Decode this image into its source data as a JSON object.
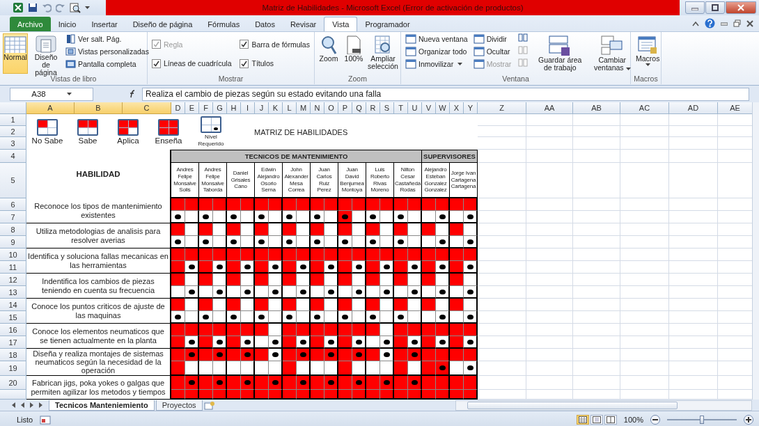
{
  "window": {
    "title": "Matriz de Habilidades  -  Microsoft Excel (Error de activación de productos)"
  },
  "ribbon_tabs": [
    {
      "label": "Archivo",
      "selected": false,
      "kind": "file"
    },
    {
      "label": "Inicio",
      "selected": false,
      "kind": "tab"
    },
    {
      "label": "Insertar",
      "selected": false,
      "kind": "tab"
    },
    {
      "label": "Diseño de página",
      "selected": false,
      "kind": "tab"
    },
    {
      "label": "Fórmulas",
      "selected": false,
      "kind": "tab"
    },
    {
      "label": "Datos",
      "selected": false,
      "kind": "tab"
    },
    {
      "label": "Revisar",
      "selected": false,
      "kind": "tab"
    },
    {
      "label": "Vista",
      "selected": true,
      "kind": "tab"
    },
    {
      "label": "Programador",
      "selected": false,
      "kind": "tab"
    }
  ],
  "ribbon": {
    "workbook_views": {
      "label": "Vistas de libro",
      "large": [
        {
          "label": "Normal",
          "selected": true
        },
        {
          "label": "Diseño de página",
          "selected": false
        }
      ],
      "small": [
        "Ver salt. Pág.",
        "Vistas personalizadas",
        "Pantalla completa"
      ]
    },
    "show": {
      "label": "Mostrar",
      "options": [
        {
          "label": "Regla",
          "checked": true,
          "disabled": true
        },
        {
          "label": "Líneas de cuadrícula",
          "checked": true,
          "disabled": false
        },
        {
          "label": "Barra de fórmulas",
          "checked": true,
          "disabled": false
        },
        {
          "label": "Títulos",
          "checked": true,
          "disabled": false
        }
      ]
    },
    "zoom": {
      "label": "Zoom",
      "buttons": [
        "Zoom",
        "100%",
        "Ampliar selección"
      ]
    },
    "window": {
      "label": "Ventana",
      "small": [
        {
          "label": "Nueva ventana",
          "disabled": false,
          "dropdown": false
        },
        {
          "label": "Organizar todo",
          "disabled": false,
          "dropdown": false
        },
        {
          "label": "Inmovilizar",
          "disabled": false,
          "dropdown": true
        },
        {
          "label": "Dividir",
          "disabled": false,
          "dropdown": false
        },
        {
          "label": "Ocultar",
          "disabled": false,
          "dropdown": false
        },
        {
          "label": "Mostrar",
          "disabled": true,
          "dropdown": false
        }
      ],
      "large": [
        {
          "label": "Guardar área de trabajo",
          "dropdown": false
        },
        {
          "label": "Cambiar ventanas",
          "dropdown": true
        }
      ]
    },
    "macros": {
      "label": "Macros",
      "buttons": [
        {
          "label": "Macros",
          "dropdown": true
        }
      ]
    }
  },
  "formula_bar": {
    "name_box": "A38",
    "formula": "Realiza el cambio de piezas según su estado evitando una falla"
  },
  "column_headers": [
    {
      "label": "A",
      "selected": true
    },
    {
      "label": "B",
      "selected": true
    },
    {
      "label": "C",
      "selected": true
    },
    {
      "label": "D",
      "selected": false
    },
    {
      "label": "E",
      "selected": false
    },
    {
      "label": "F",
      "selected": false
    },
    {
      "label": "G",
      "selected": false
    },
    {
      "label": "H",
      "selected": false
    },
    {
      "label": "I",
      "selected": false
    },
    {
      "label": "J",
      "selected": false
    },
    {
      "label": "K",
      "selected": false
    },
    {
      "label": "L",
      "selected": false
    },
    {
      "label": "M",
      "selected": false
    },
    {
      "label": "N",
      "selected": false
    },
    {
      "label": "O",
      "selected": false
    },
    {
      "label": "P",
      "selected": false
    },
    {
      "label": "Q",
      "selected": false
    },
    {
      "label": "R",
      "selected": false
    },
    {
      "label": "S",
      "selected": false
    },
    {
      "label": "T",
      "selected": false
    },
    {
      "label": "U",
      "selected": false
    },
    {
      "label": "V",
      "selected": false
    },
    {
      "label": "W",
      "selected": false
    },
    {
      "label": "X",
      "selected": false
    },
    {
      "label": "Y",
      "selected": false
    },
    {
      "label": "Z",
      "selected": false
    },
    {
      "label": "AA",
      "selected": false
    },
    {
      "label": "AB",
      "selected": false
    },
    {
      "label": "AC",
      "selected": false
    },
    {
      "label": "AD",
      "selected": false
    },
    {
      "label": "AE",
      "selected": false
    }
  ],
  "row_headers": [
    "1",
    "2",
    "3",
    "4",
    "5",
    "6",
    "7",
    "8",
    "9",
    "10",
    "11",
    "12",
    "13",
    "14",
    "15",
    "16",
    "17",
    "18",
    "19",
    "20"
  ],
  "legend": {
    "title": "MATRIZ DE HABILIDADES",
    "items": [
      {
        "label": "No Sabe",
        "quadrants": [
          true,
          false,
          false,
          false
        ],
        "dot": false
      },
      {
        "label": "Sabe",
        "quadrants": [
          true,
          true,
          false,
          false
        ],
        "dot": false
      },
      {
        "label": "Aplica",
        "quadrants": [
          true,
          true,
          true,
          false
        ],
        "dot": false
      },
      {
        "label": "Enseña",
        "quadrants": [
          true,
          true,
          true,
          true
        ],
        "dot": false
      },
      {
        "label": "Nivel Requerido",
        "quadrants": [
          false,
          false,
          false,
          false
        ],
        "dot": true
      }
    ]
  },
  "matrix": {
    "skill_header": "HABILIDAD",
    "groups": [
      {
        "label": "TECNICOS DE MANTENIMIENTO",
        "people": [
          "Andres Felipe Monsalve Solis",
          "Andres Felipe Monsalve Taborda",
          "Daniel Grisales Cano",
          "Edwin Alejandro Osorio Serna",
          "John Alexander Mesa Correa",
          "Juan Carlos Ruiz Perez",
          "Juan David Benjumea Montoya",
          "Luis Roberto Rivas Moreno",
          "Nilton Cesar Castañeda Rodas"
        ]
      },
      {
        "label": "SUPERVISORES",
        "people": [
          "Alejandro Esteban Gonzalez Gonzalez",
          "Jorge Ivan Cartagena Cartagena"
        ]
      }
    ],
    "skills": [
      {
        "label": "Reconoce los tipos de mantenimiento existentes",
        "rows": [
          {
            "red": [
              true,
              true,
              true,
              true,
              true,
              true,
              true,
              true,
              true,
              true,
              true,
              true,
              true,
              true,
              true,
              true,
              true,
              true,
              true,
              true,
              true,
              true
            ],
            "dot": [
              false,
              false,
              false,
              false,
              false,
              false,
              false,
              false,
              false,
              false,
              false,
              false,
              false,
              false,
              false,
              false,
              false,
              false,
              false,
              false,
              false,
              false
            ]
          },
          {
            "red": [
              false,
              false,
              false,
              false,
              false,
              false,
              false,
              false,
              false,
              false,
              false,
              false,
              true,
              false,
              false,
              false,
              false,
              false,
              false,
              false,
              false,
              false
            ],
            "dot": [
              true,
              false,
              true,
              false,
              true,
              false,
              true,
              false,
              true,
              false,
              true,
              false,
              true,
              false,
              true,
              false,
              true,
              false,
              false,
              true,
              false,
              true
            ]
          }
        ]
      },
      {
        "label": "Utiliza metodologias de analisis para resolver averias",
        "rows": [
          {
            "red": [
              true,
              false,
              true,
              false,
              true,
              false,
              true,
              false,
              true,
              false,
              true,
              false,
              true,
              false,
              true,
              false,
              true,
              false,
              true,
              false,
              true,
              false
            ],
            "dot": [
              false,
              false,
              false,
              false,
              false,
              false,
              false,
              false,
              false,
              false,
              false,
              false,
              false,
              false,
              false,
              false,
              false,
              false,
              false,
              false,
              false,
              false
            ]
          },
          {
            "red": [
              false,
              false,
              false,
              false,
              false,
              false,
              false,
              false,
              false,
              false,
              false,
              false,
              false,
              false,
              false,
              false,
              false,
              false,
              false,
              false,
              false,
              false
            ],
            "dot": [
              true,
              false,
              true,
              false,
              true,
              false,
              true,
              false,
              true,
              false,
              true,
              false,
              true,
              false,
              true,
              false,
              true,
              false,
              false,
              true,
              false,
              true
            ]
          }
        ]
      },
      {
        "label": "Identifica y soluciona fallas mecanicas en las herramientas",
        "rows": [
          {
            "red": [
              true,
              true,
              true,
              true,
              true,
              true,
              true,
              true,
              true,
              true,
              true,
              true,
              true,
              true,
              true,
              true,
              true,
              true,
              true,
              true,
              true,
              true
            ],
            "dot": [
              false,
              false,
              false,
              false,
              false,
              false,
              false,
              false,
              false,
              false,
              false,
              false,
              false,
              false,
              false,
              false,
              false,
              false,
              false,
              false,
              false,
              false
            ]
          },
          {
            "red": [
              true,
              false,
              true,
              false,
              true,
              false,
              true,
              false,
              true,
              false,
              true,
              false,
              true,
              false,
              true,
              false,
              true,
              false,
              true,
              false,
              true,
              false
            ],
            "dot": [
              false,
              true,
              false,
              true,
              false,
              true,
              false,
              true,
              false,
              true,
              false,
              true,
              false,
              true,
              false,
              true,
              false,
              true,
              false,
              true,
              false,
              true
            ]
          }
        ]
      },
      {
        "label": "Indentifica los cambios de piezas teniendo en cuenta su frecuencia",
        "rows": [
          {
            "red": [
              true,
              false,
              true,
              false,
              true,
              false,
              true,
              false,
              true,
              false,
              true,
              false,
              true,
              false,
              true,
              false,
              true,
              false,
              true,
              false,
              true,
              false
            ],
            "dot": [
              false,
              false,
              false,
              false,
              false,
              false,
              false,
              false,
              false,
              false,
              false,
              false,
              false,
              false,
              false,
              false,
              false,
              false,
              false,
              false,
              false,
              false
            ]
          },
          {
            "red": [
              false,
              false,
              false,
              false,
              false,
              false,
              false,
              false,
              false,
              false,
              false,
              false,
              false,
              false,
              false,
              false,
              false,
              false,
              false,
              false,
              false,
              false
            ],
            "dot": [
              false,
              true,
              false,
              true,
              false,
              true,
              false,
              true,
              false,
              true,
              false,
              true,
              false,
              true,
              false,
              true,
              false,
              true,
              false,
              true,
              false,
              true
            ]
          }
        ]
      },
      {
        "label": "Conoce los puntos criticos de ajuste de las maquinas",
        "rows": [
          {
            "red": [
              true,
              false,
              true,
              false,
              true,
              false,
              true,
              false,
              true,
              false,
              true,
              false,
              true,
              false,
              true,
              false,
              true,
              false,
              true,
              false,
              true,
              false
            ],
            "dot": [
              false,
              false,
              false,
              false,
              false,
              false,
              false,
              false,
              false,
              false,
              false,
              false,
              false,
              false,
              false,
              false,
              false,
              false,
              false,
              false,
              false,
              false
            ]
          },
          {
            "red": [
              false,
              false,
              false,
              false,
              false,
              false,
              false,
              false,
              false,
              false,
              false,
              false,
              false,
              false,
              false,
              false,
              false,
              false,
              false,
              false,
              false,
              false
            ],
            "dot": [
              true,
              false,
              true,
              false,
              true,
              false,
              true,
              false,
              true,
              false,
              true,
              false,
              true,
              false,
              true,
              false,
              true,
              false,
              false,
              true,
              false,
              true
            ]
          }
        ]
      },
      {
        "label": "Conoce los elementos neumaticos que se tienen actualmente en la planta",
        "rows": [
          {
            "red": [
              true,
              true,
              true,
              true,
              true,
              true,
              true,
              false,
              true,
              true,
              true,
              true,
              true,
              true,
              true,
              false,
              true,
              true,
              true,
              true,
              true,
              true
            ],
            "dot": [
              false,
              false,
              false,
              false,
              false,
              false,
              false,
              false,
              false,
              false,
              false,
              false,
              false,
              false,
              false,
              false,
              false,
              false,
              false,
              false,
              false,
              false
            ]
          },
          {
            "red": [
              true,
              false,
              true,
              false,
              true,
              false,
              false,
              false,
              true,
              false,
              true,
              false,
              true,
              false,
              false,
              false,
              true,
              false,
              true,
              false,
              true,
              false
            ],
            "dot": [
              false,
              true,
              false,
              true,
              false,
              true,
              false,
              true,
              false,
              true,
              false,
              true,
              false,
              true,
              false,
              true,
              false,
              true,
              false,
              true,
              false,
              true
            ]
          }
        ]
      },
      {
        "label": "Diseña y realiza montajes de sistemas neumaticos según la necesidad de la operación",
        "rows": [
          {
            "red": [
              true,
              true,
              true,
              true,
              true,
              true,
              true,
              false,
              true,
              true,
              true,
              true,
              true,
              true,
              true,
              false,
              true,
              true,
              true,
              true,
              true,
              true
            ],
            "dot": [
              false,
              true,
              false,
              true,
              false,
              true,
              false,
              true,
              false,
              true,
              false,
              true,
              false,
              true,
              false,
              true,
              false,
              true,
              false,
              false,
              false,
              false
            ]
          },
          {
            "red": [
              true,
              false,
              false,
              false,
              false,
              false,
              false,
              false,
              true,
              false,
              false,
              false,
              true,
              false,
              false,
              false,
              true,
              false,
              true,
              true,
              false,
              false
            ],
            "dot": [
              false,
              false,
              false,
              false,
              false,
              false,
              false,
              false,
              false,
              false,
              false,
              false,
              false,
              false,
              false,
              false,
              false,
              false,
              false,
              true,
              false,
              true
            ]
          }
        ]
      },
      {
        "label": "Fabrican jigs, poka yokes o galgas que permiten agilizar los metodos y tiempos",
        "rows": [
          {
            "red": [
              true,
              true,
              true,
              true,
              true,
              true,
              true,
              true,
              true,
              true,
              true,
              true,
              true,
              true,
              true,
              true,
              true,
              true,
              true,
              true,
              true,
              true
            ],
            "dot": [
              false,
              true,
              false,
              true,
              false,
              true,
              false,
              true,
              false,
              true,
              false,
              true,
              false,
              true,
              false,
              true,
              false,
              true,
              false,
              false,
              false,
              false
            ]
          },
          {
            "red": [
              true,
              true,
              true,
              true,
              true,
              true,
              true,
              true,
              true,
              true,
              true,
              true,
              true,
              true,
              true,
              true,
              true,
              true,
              true,
              true,
              true,
              true
            ],
            "dot": [
              false,
              false,
              false,
              false,
              false,
              false,
              false,
              false,
              false,
              false,
              false,
              false,
              false,
              false,
              false,
              false,
              false,
              false,
              false,
              false,
              false,
              false
            ]
          }
        ]
      }
    ]
  },
  "sheet_tabs": [
    {
      "label": "Tecnicos Manteniemiento",
      "selected": true
    },
    {
      "label": "Proyectos",
      "selected": false
    }
  ],
  "status_bar": {
    "status": "Listo",
    "zoom": "100%",
    "zoom_slider": {
      "level": 0.5
    }
  }
}
